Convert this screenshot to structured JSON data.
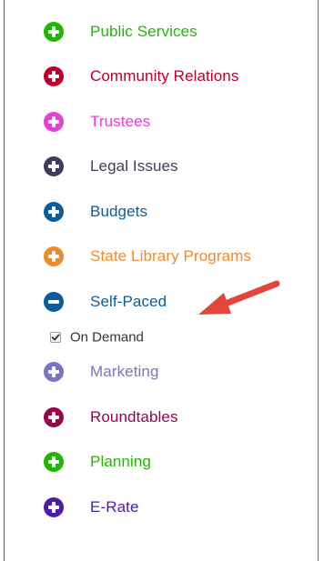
{
  "menu": {
    "items": [
      {
        "id": "public-services",
        "label": "Public Services",
        "color": "#1fb800",
        "state": "collapsed"
      },
      {
        "id": "community-relations",
        "label": "Community Relations",
        "color": "#b8002a",
        "state": "collapsed"
      },
      {
        "id": "trustees",
        "label": "Trustees",
        "color": "#e641d2",
        "state": "collapsed"
      },
      {
        "id": "legal-issues",
        "label": "Legal Issues",
        "color": "#3e3e5c",
        "state": "collapsed"
      },
      {
        "id": "budgets",
        "label": "Budgets",
        "color": "#0a5c9e",
        "state": "collapsed"
      },
      {
        "id": "state-library-programs",
        "label": "State Library Programs",
        "color": "#f08a2c",
        "state": "collapsed"
      },
      {
        "id": "self-paced",
        "label": "Self-Paced",
        "color": "#0a5c9e",
        "state": "expanded"
      },
      {
        "id": "marketing",
        "label": "Marketing",
        "color": "#7a72c2",
        "state": "collapsed"
      },
      {
        "id": "roundtables",
        "label": "Roundtables",
        "color": "#a0004a",
        "state": "collapsed"
      },
      {
        "id": "planning",
        "label": "Planning",
        "color": "#1fb800",
        "state": "collapsed"
      },
      {
        "id": "e-rate",
        "label": "E-Rate",
        "color": "#4a1ea8",
        "state": "collapsed"
      }
    ],
    "self_paced_sub": {
      "label": "On Demand",
      "checked": true
    }
  },
  "icons": {
    "collapsed": "plus-circle-icon",
    "expanded": "minus-circle-icon",
    "checkbox": "checkmark-icon",
    "annotation": "red-arrow-icon"
  },
  "colors": {
    "arrow": "#e2463b",
    "border": "#6a6a6a"
  }
}
